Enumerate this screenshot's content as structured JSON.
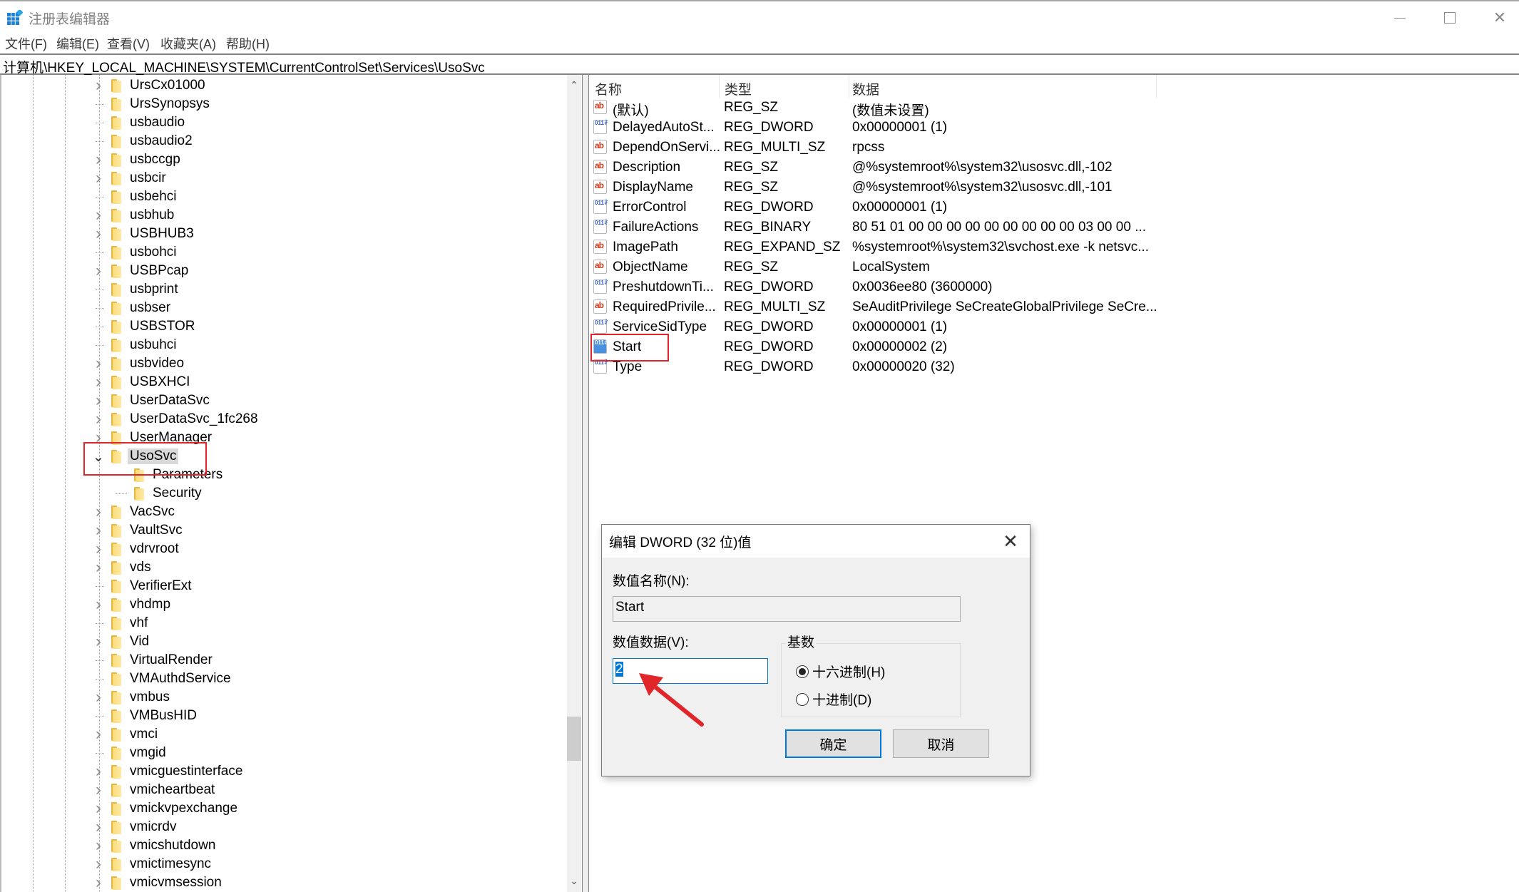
{
  "window": {
    "title": "注册表编辑器",
    "controls": {
      "minimize": "—",
      "maximize": "☐",
      "close": "✕"
    }
  },
  "menu": [
    "文件(F)",
    "编辑(E)",
    "查看(V)",
    "收藏夹(A)",
    "帮助(H)"
  ],
  "address": "计算机\\HKEY_LOCAL_MACHINE\\SYSTEM\\CurrentControlSet\\Services\\UsoSvc",
  "tree": {
    "items": [
      {
        "label": "UrsCx01000",
        "expandable": true
      },
      {
        "label": "UrsSynopsys",
        "expandable": false
      },
      {
        "label": "usbaudio",
        "expandable": false
      },
      {
        "label": "usbaudio2",
        "expandable": false
      },
      {
        "label": "usbccgp",
        "expandable": true
      },
      {
        "label": "usbcir",
        "expandable": true
      },
      {
        "label": "usbehci",
        "expandable": false
      },
      {
        "label": "usbhub",
        "expandable": true
      },
      {
        "label": "USBHUB3",
        "expandable": true
      },
      {
        "label": "usbohci",
        "expandable": false
      },
      {
        "label": "USBPcap",
        "expandable": true
      },
      {
        "label": "usbprint",
        "expandable": false
      },
      {
        "label": "usbser",
        "expandable": false
      },
      {
        "label": "USBSTOR",
        "expandable": false
      },
      {
        "label": "usbuhci",
        "expandable": false
      },
      {
        "label": "usbvideo",
        "expandable": true
      },
      {
        "label": "USBXHCI",
        "expandable": true
      },
      {
        "label": "UserDataSvc",
        "expandable": true
      },
      {
        "label": "UserDataSvc_1fc268",
        "expandable": true
      },
      {
        "label": "UserManager",
        "expandable": true
      },
      {
        "label": "UsoSvc",
        "expandable": true,
        "expanded": true,
        "selected": true
      },
      {
        "label": "Parameters",
        "child": true
      },
      {
        "label": "Security",
        "child": true
      },
      {
        "label": "VacSvc",
        "expandable": true
      },
      {
        "label": "VaultSvc",
        "expandable": true
      },
      {
        "label": "vdrvroot",
        "expandable": true
      },
      {
        "label": "vds",
        "expandable": true
      },
      {
        "label": "VerifierExt",
        "expandable": false
      },
      {
        "label": "vhdmp",
        "expandable": true
      },
      {
        "label": "vhf",
        "expandable": false
      },
      {
        "label": "Vid",
        "expandable": true
      },
      {
        "label": "VirtualRender",
        "expandable": false
      },
      {
        "label": "VMAuthdService",
        "expandable": false
      },
      {
        "label": "vmbus",
        "expandable": true
      },
      {
        "label": "VMBusHID",
        "expandable": false
      },
      {
        "label": "vmci",
        "expandable": true
      },
      {
        "label": "vmgid",
        "expandable": false
      },
      {
        "label": "vmicguestinterface",
        "expandable": true
      },
      {
        "label": "vmicheartbeat",
        "expandable": true
      },
      {
        "label": "vmickvpexchange",
        "expandable": true
      },
      {
        "label": "vmicrdv",
        "expandable": true
      },
      {
        "label": "vmicshutdown",
        "expandable": true
      },
      {
        "label": "vmictimesync",
        "expandable": true
      },
      {
        "label": "vmicvmsession",
        "expandable": true
      }
    ]
  },
  "list": {
    "headers": {
      "name": "名称",
      "type": "类型",
      "data": "数据"
    },
    "rows": [
      {
        "icon": "ab",
        "name": "(默认)",
        "type": "REG_SZ",
        "data": "(数值未设置)"
      },
      {
        "icon": "bin",
        "name": "DelayedAutoSt...",
        "type": "REG_DWORD",
        "data": "0x00000001 (1)"
      },
      {
        "icon": "ab",
        "name": "DependOnServi...",
        "type": "REG_MULTI_SZ",
        "data": "rpcss"
      },
      {
        "icon": "ab",
        "name": "Description",
        "type": "REG_SZ",
        "data": "@%systemroot%\\system32\\usosvc.dll,-102"
      },
      {
        "icon": "ab",
        "name": "DisplayName",
        "type": "REG_SZ",
        "data": "@%systemroot%\\system32\\usosvc.dll,-101"
      },
      {
        "icon": "bin",
        "name": "ErrorControl",
        "type": "REG_DWORD",
        "data": "0x00000001 (1)"
      },
      {
        "icon": "bin",
        "name": "FailureActions",
        "type": "REG_BINARY",
        "data": "80 51 01 00 00 00 00 00 00 00 00 00 03 00 00 ..."
      },
      {
        "icon": "ab",
        "name": "ImagePath",
        "type": "REG_EXPAND_SZ",
        "data": "%systemroot%\\system32\\svchost.exe -k netsvc..."
      },
      {
        "icon": "ab",
        "name": "ObjectName",
        "type": "REG_SZ",
        "data": "LocalSystem"
      },
      {
        "icon": "bin",
        "name": "PreshutdownTi...",
        "type": "REG_DWORD",
        "data": "0x0036ee80 (3600000)"
      },
      {
        "icon": "ab",
        "name": "RequiredPrivile...",
        "type": "REG_MULTI_SZ",
        "data": "SeAuditPrivilege SeCreateGlobalPrivilege SeCre..."
      },
      {
        "icon": "bin",
        "name": "ServiceSidType",
        "type": "REG_DWORD",
        "data": "0x00000001 (1)"
      },
      {
        "icon": "bin",
        "name": "Start",
        "type": "REG_DWORD",
        "data": "0x00000002 (2)",
        "selected": true
      },
      {
        "icon": "bin",
        "name": "Type",
        "type": "REG_DWORD",
        "data": "0x00000020 (32)"
      }
    ]
  },
  "dialog": {
    "title": "编辑 DWORD (32 位)值",
    "close": "✕",
    "name_label": "数值名称(N):",
    "name_value": "Start",
    "data_label": "数值数据(V):",
    "data_value": "2",
    "base_label": "基数",
    "radios": [
      {
        "label": "十六进制(H)",
        "checked": true
      },
      {
        "label": "十进制(D)",
        "checked": false
      }
    ],
    "ok": "确定",
    "cancel": "取消"
  },
  "annotations": {
    "highlight_color": "#e0262b",
    "arrow_color": "#e0262b"
  }
}
